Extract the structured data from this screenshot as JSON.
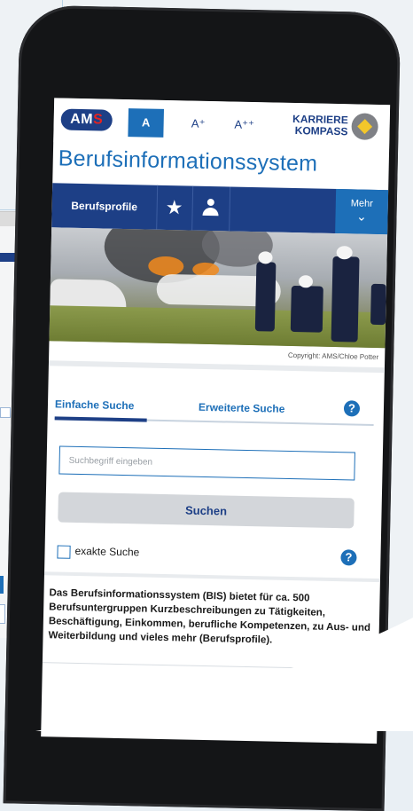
{
  "header": {
    "logo_ams_a": "AM",
    "logo_ams_s": "S",
    "font_sizes": [
      "A",
      "A⁺",
      "A⁺⁺"
    ],
    "karriere_line1": "KARRIERE",
    "karriere_line2": "KOMPASS",
    "title": "Berufsinformationssystem"
  },
  "nav": {
    "profile_label": "Berufsprofile",
    "favorites_icon": "star-icon",
    "account_icon": "user-icon",
    "more_label": "Mehr",
    "more_chevron": "⌄"
  },
  "hero": {
    "copyright": "Copyright: AMS/Chloe Potter"
  },
  "search": {
    "tab_simple": "Einfache Suche",
    "tab_advanced": "Erweiterte Suche",
    "help_symbol": "?",
    "placeholder": "Suchbegriff eingeben",
    "button_label": "Suchen",
    "exact_label": "exakte Suche"
  },
  "description": "Das Berufsinformationssystem (BIS) bietet für ca. 500 Berufsuntergruppen Kurzbeschreibungen zu Tätigkeiten, Beschäftigung, Einkommen, berufliche Kompetenzen, zu Aus- und Weiterbildung und vieles mehr (Berufsprofile).",
  "colors": {
    "brand_dark_blue": "#1d3f86",
    "brand_blue": "#1d6fb8",
    "ams_red": "#e52320",
    "button_grey": "#d3d6da"
  }
}
